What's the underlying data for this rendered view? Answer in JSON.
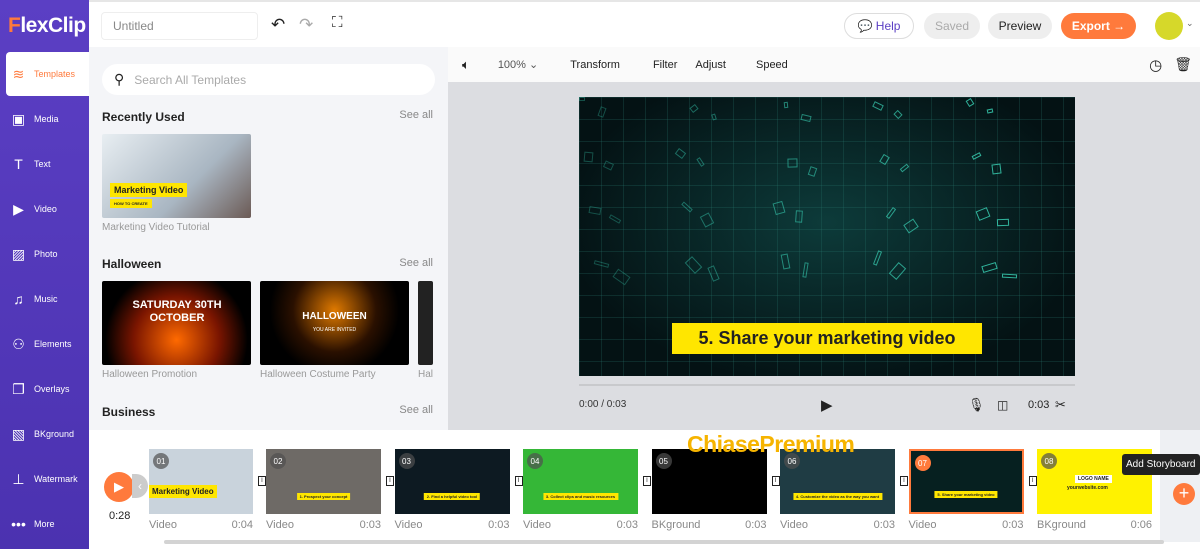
{
  "app": {
    "logo": "FlexClip",
    "logo_first": "F",
    "logo_rest": "lexClip"
  },
  "sidebar": {
    "items": [
      {
        "label": "Templates",
        "icon": "layers-icon",
        "glyph": "≋",
        "active": true
      },
      {
        "label": "Media",
        "icon": "folder-icon",
        "glyph": "▣"
      },
      {
        "label": "Text",
        "icon": "text-icon",
        "glyph": "T"
      },
      {
        "label": "Video",
        "icon": "video-icon",
        "glyph": "▶"
      },
      {
        "label": "Photo",
        "icon": "photo-icon",
        "glyph": "▨"
      },
      {
        "label": "Music",
        "icon": "music-icon",
        "glyph": "♫"
      },
      {
        "label": "Elements",
        "icon": "elements-icon",
        "glyph": "⚇"
      },
      {
        "label": "Overlays",
        "icon": "overlays-icon",
        "glyph": "❐"
      },
      {
        "label": "BKground",
        "icon": "background-icon",
        "glyph": "▧"
      },
      {
        "label": "Watermark",
        "icon": "stamp-icon",
        "glyph": "⊥"
      },
      {
        "label": "More",
        "icon": "more-icon",
        "glyph": "•••"
      }
    ]
  },
  "header": {
    "title": "Untitled",
    "help": "Help",
    "saved": "Saved",
    "preview": "Preview",
    "export": "Export →"
  },
  "panel": {
    "search_placeholder": "Search All Templates",
    "see_all": "See all",
    "sections": [
      {
        "title": "Recently Used",
        "items": [
          {
            "caption": "Marketing Video Tutorial",
            "thumb_title": "Marketing Video",
            "thumb_sub": "HOW TO CREATE"
          }
        ]
      },
      {
        "title": "Halloween",
        "items": [
          {
            "caption": "Halloween Promotion",
            "thumb_title": "SATURDAY 30TH OCTOBER"
          },
          {
            "caption": "Halloween Costume Party",
            "thumb_title": "HALLOWEEN",
            "thumb_sub": "YOU ARE INVITED"
          },
          {
            "caption": "Hal"
          }
        ]
      },
      {
        "title": "Business"
      }
    ]
  },
  "toolbar": {
    "zoom": "100%",
    "transform": "Transform",
    "filter": "Filter",
    "adjust": "Adjust",
    "speed": "Speed"
  },
  "player": {
    "caption": "5. Share your marketing video",
    "time": "0:00 / 0:03",
    "duration": "0:03"
  },
  "timeline": {
    "total": "0:28",
    "watermark": "ChiasePremium",
    "tooltip": "Add Storyboard",
    "clips": [
      {
        "num": "01",
        "type": "Video",
        "dur": "0:04",
        "text": "Marketing Video",
        "bg": "#c9d3dc"
      },
      {
        "num": "02",
        "type": "Video",
        "dur": "0:03",
        "text": "1. Prospect your concept",
        "bg": "#6e6a66"
      },
      {
        "num": "03",
        "type": "Video",
        "dur": "0:03",
        "text": "2. Find a helpful video tool",
        "bg": "#0d1a22"
      },
      {
        "num": "04",
        "type": "Video",
        "dur": "0:03",
        "text": "3. Collect clips and music resources",
        "bg": "#35b737"
      },
      {
        "num": "05",
        "type": "BKground",
        "dur": "0:03",
        "text": "",
        "bg": "#000000"
      },
      {
        "num": "06",
        "type": "Video",
        "dur": "0:03",
        "text": "4. Customize the video as the way you want",
        "bg": "#1f3c44"
      },
      {
        "num": "07",
        "type": "Video",
        "dur": "0:03",
        "text": "5. Share your marketing video",
        "bg": "#062020",
        "selected": true
      },
      {
        "num": "08",
        "type": "BKground",
        "dur": "0:06",
        "text": "LOGO NAME",
        "sub": "yourwebsite.com",
        "bg": "#fff200"
      }
    ]
  },
  "colors": {
    "accent": "#ff7a3c",
    "sidebar": "#5b3fc4",
    "caption": "#ffe600"
  }
}
